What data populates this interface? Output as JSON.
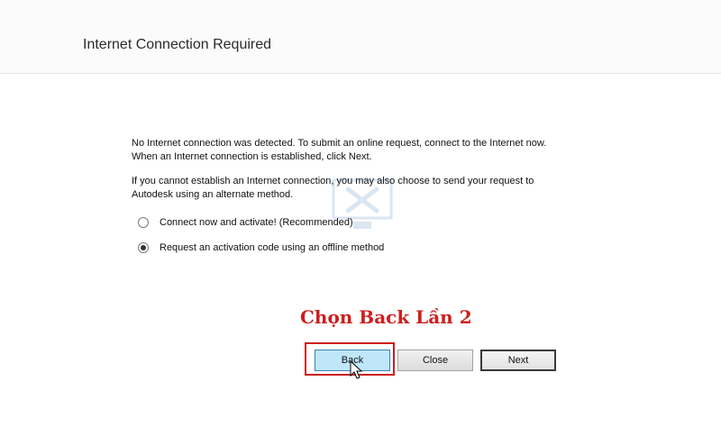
{
  "header": {
    "title": "Internet Connection Required"
  },
  "body": {
    "paragraph1_line1": "No Internet connection was detected. To submit an online request, connect to the Internet now.",
    "paragraph1_line2": "When an Internet connection is established, click Next.",
    "paragraph2_line1": "If you cannot establish an Internet connection, you may also choose to send your request to",
    "paragraph2_line2": "Autodesk using an alternate method."
  },
  "options": [
    {
      "label": "Connect now and activate! (Recommended)",
      "selected": false
    },
    {
      "label": "Request an activation code using an offline method",
      "selected": true
    }
  ],
  "annotation": {
    "text": "Chọn Back Lần 2",
    "color": "#cc1f1f"
  },
  "buttons": {
    "back": "Back",
    "close": "Close",
    "next": "Next"
  },
  "colors": {
    "back_button_bg": "#bfe6fb",
    "highlight": "#cc1f1f"
  }
}
